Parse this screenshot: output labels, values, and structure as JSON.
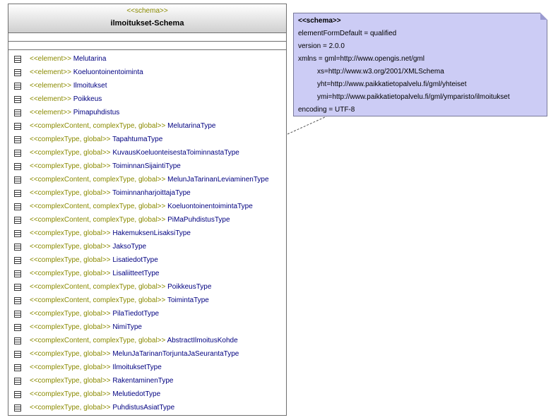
{
  "class_box": {
    "stereotype": "<<schema>>",
    "name": "ilmoitukset-Schema",
    "items": [
      {
        "stereotype": "<<element>>",
        "name": "Melutarina"
      },
      {
        "stereotype": "<<element>>",
        "name": "Koeluontoinentoiminta"
      },
      {
        "stereotype": "<<element>>",
        "name": "Ilmoitukset"
      },
      {
        "stereotype": "<<element>>",
        "name": "Poikkeus"
      },
      {
        "stereotype": "<<element>>",
        "name": "Pimapuhdistus"
      },
      {
        "stereotype": "<<complexContent, complexType, global>>",
        "name": "MelutarinaType"
      },
      {
        "stereotype": "<<complexType, global>>",
        "name": "TapahtumaType"
      },
      {
        "stereotype": "<<complexType, global>>",
        "name": "KuvausKoeluonteisestaToiminnastaType"
      },
      {
        "stereotype": "<<complexType, global>>",
        "name": "ToiminnanSijaintiType"
      },
      {
        "stereotype": "<<complexContent, complexType, global>>",
        "name": "MelunJaTarinanLeviaminenType"
      },
      {
        "stereotype": "<<complexType, global>>",
        "name": "ToiminnanharjoittajaType"
      },
      {
        "stereotype": "<<complexContent, complexType, global>>",
        "name": "KoeluontoinentoimintaType"
      },
      {
        "stereotype": "<<complexContent, complexType, global>>",
        "name": "PiMaPuhdistusType"
      },
      {
        "stereotype": "<<complexType, global>>",
        "name": "HakemuksenLisaksiType"
      },
      {
        "stereotype": "<<complexType, global>>",
        "name": "JaksoType"
      },
      {
        "stereotype": "<<complexType, global>>",
        "name": "LisatiedotType"
      },
      {
        "stereotype": "<<complexType, global>>",
        "name": "LisaliitteetType"
      },
      {
        "stereotype": "<<complexContent, complexType, global>>",
        "name": "PoikkeusType"
      },
      {
        "stereotype": "<<complexContent, complexType, global>>",
        "name": "ToimintaType"
      },
      {
        "stereotype": "<<complexType, global>>",
        "name": "PilaTiedotType"
      },
      {
        "stereotype": "<<complexType, global>>",
        "name": "NimiType"
      },
      {
        "stereotype": "<<complexContent, complexType, global>>",
        "name": "AbstractIlmoitusKohde"
      },
      {
        "stereotype": "<<complexType, global>>",
        "name": "MelunJaTarinanTorjuntaJaSeurantaType"
      },
      {
        "stereotype": "<<complexType, global>>",
        "name": "IlmoituksetType"
      },
      {
        "stereotype": "<<complexType, global>>",
        "name": "RakentaminenType"
      },
      {
        "stereotype": "<<complexType, global>>",
        "name": "MelutiedotType"
      },
      {
        "stereotype": "<<complexType, global>>",
        "name": "PuhdistusAsiatType"
      }
    ]
  },
  "note": {
    "title": "<<schema>>",
    "lines": [
      {
        "text": "elementFormDefault = qualified",
        "indent": false
      },
      {
        "text": "version = 2.0.0",
        "indent": false
      },
      {
        "text": "xmlns = gml=http://www.opengis.net/gml",
        "indent": false
      },
      {
        "text": "xs=http://www.w3.org/2001/XMLSchema",
        "indent": true
      },
      {
        "text": "yht=http://www.paikkatietopalvelu.fi/gml/yhteiset",
        "indent": true
      },
      {
        "text": "ymi=http://www.paikkatietopalvelu.fi/gml/ymparisto/ilmoitukset",
        "indent": true
      },
      {
        "text": "encoding = UTF-8",
        "indent": false
      }
    ]
  },
  "colors": {
    "stereotype": "#8a8a00",
    "name": "#000080",
    "note_bg": "#ccccf5"
  }
}
